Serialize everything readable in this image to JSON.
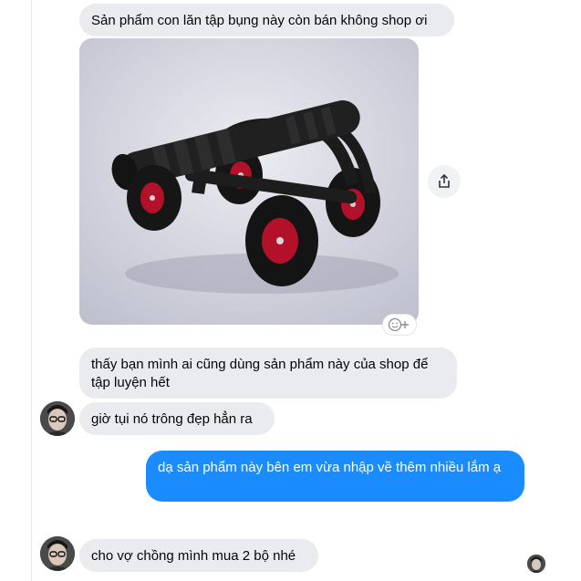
{
  "messages": {
    "m1": "Sản phẩm con lăn tập bụng này còn bán không shop ơi",
    "m2": "thấy bạn mình ai cũng dùng sản phẩm này của shop để tập luyện hết",
    "m3": "giờ tụi nó trông đẹp hẳn ra",
    "m4": "dạ sản phẩm này bên em vừa nhập về thêm nhiều lắm ạ",
    "m5": "cho vợ chồng mình mua 2 bộ nhé"
  },
  "colors": {
    "incoming_bubble": "#e9ebee",
    "outgoing_bubble": "#1a8cff"
  },
  "icons": {
    "share": "share-icon",
    "reaction": "add-reaction-icon"
  }
}
